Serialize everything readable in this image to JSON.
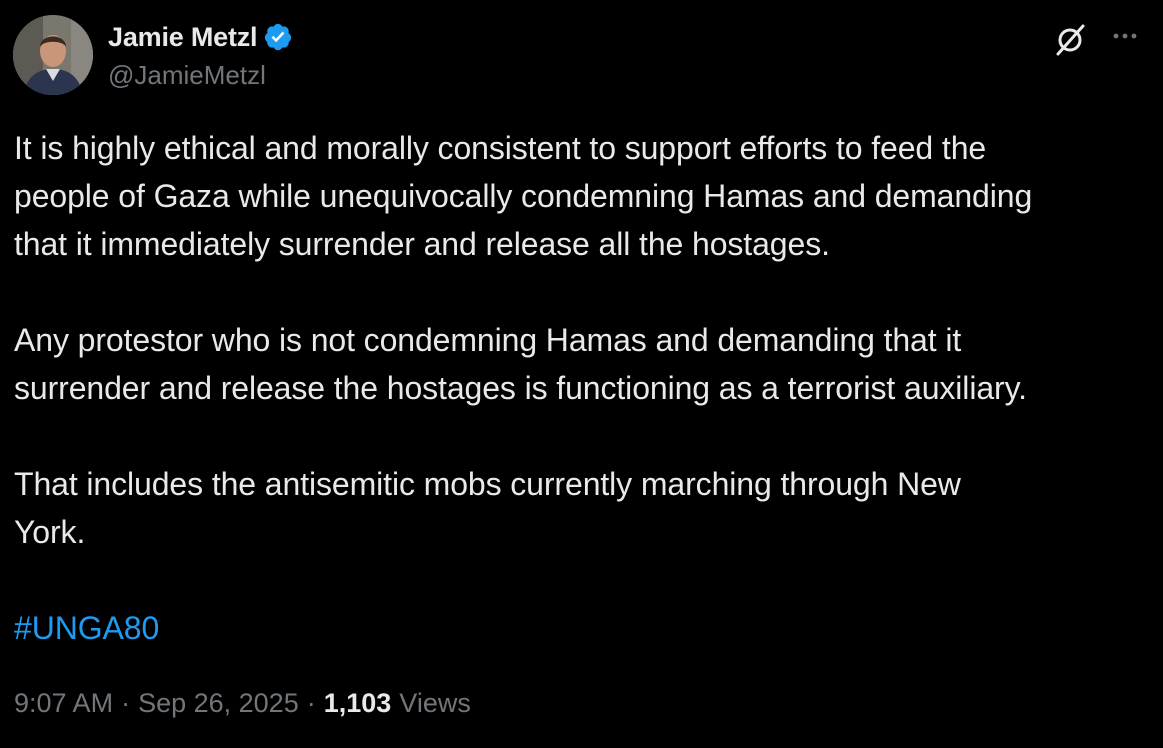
{
  "author": {
    "display_name": "Jamie Metzl",
    "handle": "@JamieMetzl",
    "verified_color": "#1d9bf0"
  },
  "icons": {
    "grok": "grok-icon",
    "more": "more-icon",
    "verified": "verified-badge-icon"
  },
  "tweet": {
    "paragraphs": [
      "It is highly ethical and morally consistent to support efforts to feed the\npeople of Gaza while unequivocally condemning Hamas and demanding\nthat it immediately surrender and release all the hostages.",
      "Any protestor who is not condemning Hamas and demanding that it\nsurrender and release the hostages is functioning as a terrorist auxiliary.",
      "That includes the antisemitic mobs currently marching through New\nYork."
    ],
    "hashtag": "#UNGA80"
  },
  "meta": {
    "time": "9:07 AM",
    "separator": "·",
    "date": "Sep 26, 2025",
    "views_count": "1,103",
    "views_label": "Views"
  },
  "colors": {
    "background": "#000000",
    "text": "#e7e9ea",
    "secondary": "#71767b",
    "link": "#1d9bf0"
  }
}
